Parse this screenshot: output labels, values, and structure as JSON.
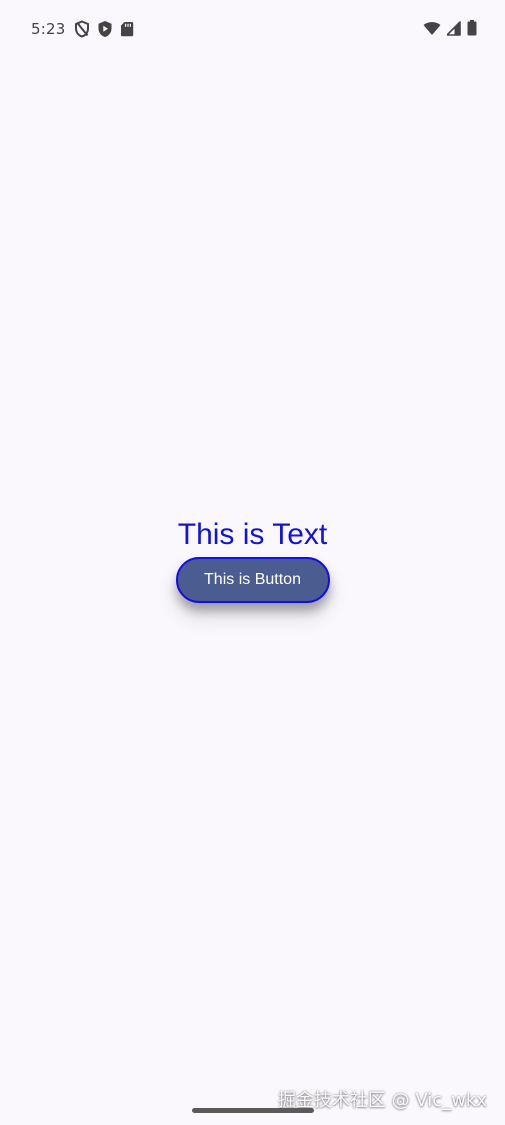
{
  "status_bar": {
    "time": "5:23",
    "left_icons": [
      "shield-slash-icon",
      "play-protect-icon",
      "sd-card-icon"
    ],
    "right_icons": [
      "wifi-icon",
      "cell-signal-icon",
      "battery-icon"
    ]
  },
  "content": {
    "text": "This is Text",
    "button_label": "This is Button"
  },
  "watermark": {
    "text": "掘金技术社区 @ Vic_wkx"
  },
  "colors": {
    "background": "#FAF8FD",
    "text": "#1313D8",
    "button_fill": "#4B5C91",
    "button_border": "#1010E6",
    "button_text": "#FFFFFF"
  }
}
